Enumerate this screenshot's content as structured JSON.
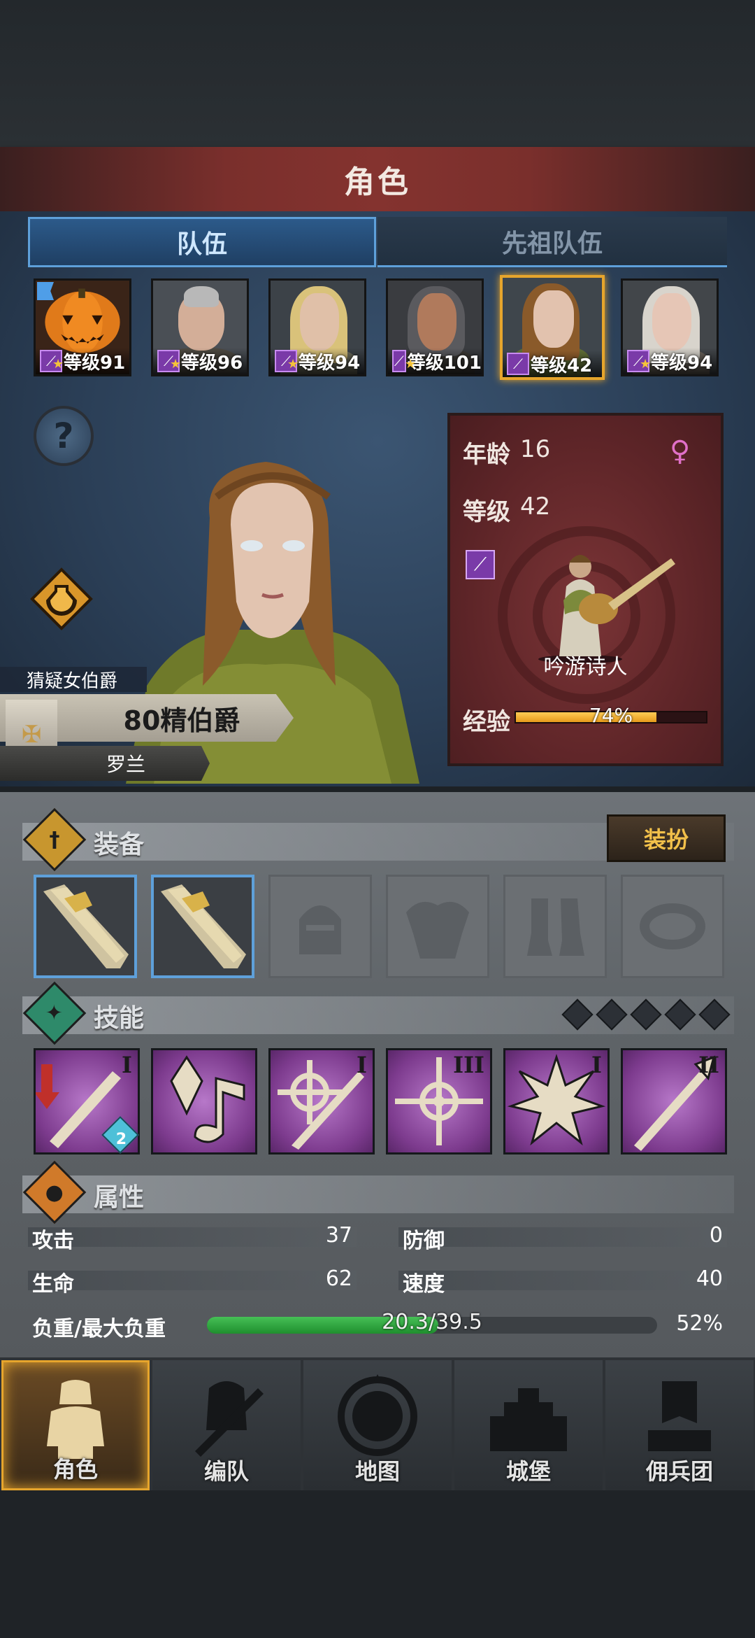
{
  "header": {
    "title": "角色"
  },
  "tabs": [
    {
      "label": "队伍",
      "active": true
    },
    {
      "label": "先祖队伍",
      "active": false
    }
  ],
  "heroes": [
    {
      "level_text": "等级91",
      "class_icon": "staff-icon",
      "portrait": "pumpkin-knight",
      "has_flag": true
    },
    {
      "level_text": "等级96",
      "class_icon": "staff-icon",
      "portrait": "mohawk-warrior"
    },
    {
      "level_text": "等级94",
      "class_icon": "staff-icon",
      "portrait": "blonde-elf"
    },
    {
      "level_text": "等级101",
      "class_icon": "staff-icon",
      "portrait": "dark-elf"
    },
    {
      "level_text": "等级42",
      "class_icon": "staff-icon",
      "portrait": "brown-haired-bard",
      "selected": true
    },
    {
      "level_text": "等级94",
      "class_icon": "staff-icon",
      "portrait": "white-haired-elf"
    }
  ],
  "character": {
    "nobility_label": "猜疑女伯爵",
    "rank": "80精伯爵",
    "name": "罗兰",
    "age_label": "年龄",
    "age": "16",
    "level_label": "等级",
    "level": "42",
    "gender_icon": "female-icon",
    "class_name": "吟游诗人",
    "exp_label": "经验",
    "exp_percent_text": "74%",
    "exp_fraction": 0.74
  },
  "equipment": {
    "section_title": "装备",
    "outfit_button": "装扮",
    "slots": [
      {
        "type": "weapon",
        "filled": true,
        "icon": "golden-staff-icon"
      },
      {
        "type": "offhand",
        "filled": true,
        "icon": "golden-staff-icon"
      },
      {
        "type": "helmet",
        "filled": false,
        "icon": "helmet-icon"
      },
      {
        "type": "armor",
        "filled": false,
        "icon": "armor-icon"
      },
      {
        "type": "boots",
        "filled": false,
        "icon": "boots-icon"
      },
      {
        "type": "ring",
        "filled": false,
        "icon": "ring-icon"
      }
    ]
  },
  "skills": {
    "section_title": "技能",
    "pips": 5,
    "cards": [
      {
        "icon": "dagger-strike-icon",
        "rank": "I",
        "badge": "2"
      },
      {
        "icon": "music-crystal-icon",
        "rank": ""
      },
      {
        "icon": "target-spear-icon",
        "rank": "I"
      },
      {
        "icon": "holy-cross-icon",
        "rank": "III"
      },
      {
        "icon": "burst-icon",
        "rank": "I"
      },
      {
        "icon": "spear-icon",
        "rank": "II"
      }
    ]
  },
  "attributes": {
    "section_title": "属性",
    "attack_label": "攻击",
    "attack": "37",
    "defense_label": "防御",
    "defense": "0",
    "hp_label": "生命",
    "hp": "62",
    "speed_label": "速度",
    "speed": "40",
    "load_label": "负重/最大负重",
    "load_text": "20.3/39.5",
    "load_percent_text": "52%",
    "load_fraction": 0.514
  },
  "nav": [
    {
      "label": "角色",
      "icon": "knight-icon",
      "active": true
    },
    {
      "label": "编队",
      "icon": "helmet-sword-icon"
    },
    {
      "label": "地图",
      "icon": "compass-map-icon"
    },
    {
      "label": "城堡",
      "icon": "castle-icon"
    },
    {
      "label": "佣兵团",
      "icon": "mercenary-banner-icon"
    }
  ],
  "colors": {
    "accent_gold": "#e6a52c",
    "tab_blue": "#5ea0da",
    "skill_purple": "#8a45a0",
    "exp_orange": "#f0a828",
    "load_green": "#2fa03e",
    "card_red": "#6a2a2c"
  }
}
